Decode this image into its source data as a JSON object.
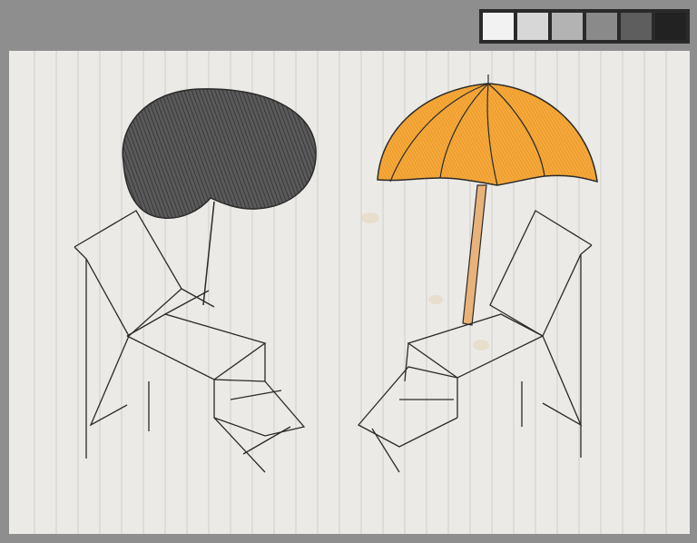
{
  "colors": {
    "background": "#8e8e8e",
    "paper": "#eceae6",
    "ruled_line": "#cfcdca",
    "pencil": "#2a2a2a",
    "dark_canopy": "#4a4a4a",
    "orange_canopy": "#f4a73a",
    "umbrella_pole": "#e8b27a"
  },
  "color_strip": {
    "swatches": [
      "#f2f2f2",
      "#d7d7d7",
      "#b3b3b3",
      "#8a8a8a",
      "#5e5e5e",
      "#222222"
    ]
  },
  "drawing": {
    "left_umbrella": "dark-shaded-canopy",
    "right_umbrella": "orange-striped-canopy",
    "chairs": 2
  }
}
